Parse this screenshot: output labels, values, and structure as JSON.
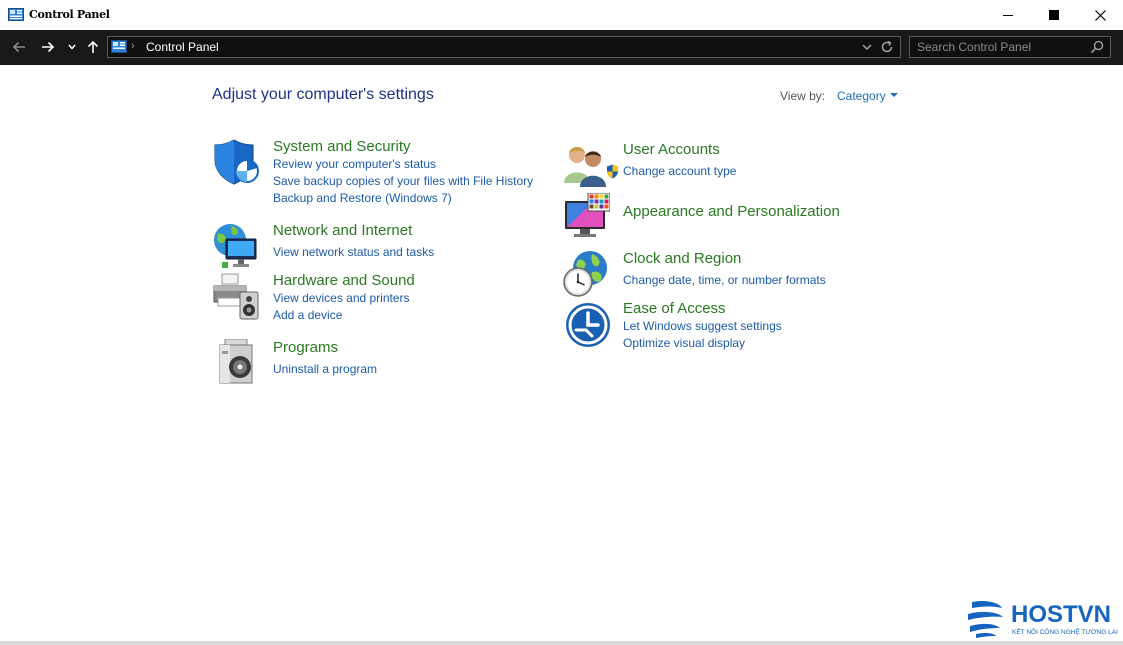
{
  "window": {
    "title": "Control Panel"
  },
  "nav": {
    "breadcrumb": "Control Panel",
    "search_placeholder": "Search Control Panel"
  },
  "main": {
    "heading": "Adjust your computer's settings",
    "view_by_label": "View by:",
    "view_by_value": "Category"
  },
  "categories": [
    {
      "title": "System and Security",
      "icon": "shield-icon",
      "links": [
        "Review your computer's status",
        "Save backup copies of your files with File History",
        "Backup and Restore (Windows 7)"
      ]
    },
    {
      "title": "Network and Internet",
      "icon": "network-globe-icon",
      "links": [
        "View network status and tasks"
      ]
    },
    {
      "title": "Hardware and Sound",
      "icon": "printer-speaker-icon",
      "links": [
        "View devices and printers",
        "Add a device"
      ]
    },
    {
      "title": "Programs",
      "icon": "programs-disc-icon",
      "links": [
        "Uninstall a program"
      ]
    },
    {
      "title": "User Accounts",
      "icon": "users-icon",
      "links": [
        "Change account type"
      ]
    },
    {
      "title": "Appearance and Personalization",
      "icon": "monitor-palette-icon",
      "links": []
    },
    {
      "title": "Clock and Region",
      "icon": "clock-globe-icon",
      "links": [
        "Change date, time, or number formats"
      ]
    },
    {
      "title": "Ease of Access",
      "icon": "ease-of-access-icon",
      "links": [
        "Let Windows suggest settings",
        "Optimize visual display"
      ]
    }
  ],
  "watermark": {
    "brand": "HOSTVN",
    "tagline": "KẾT NỐI CÔNG NGHỆ TƯƠNG LAI"
  },
  "colors": {
    "category_title": "#2a7a22",
    "link": "#1e5ca8",
    "heading": "#1e3287",
    "navbar_bg": "#191919"
  }
}
